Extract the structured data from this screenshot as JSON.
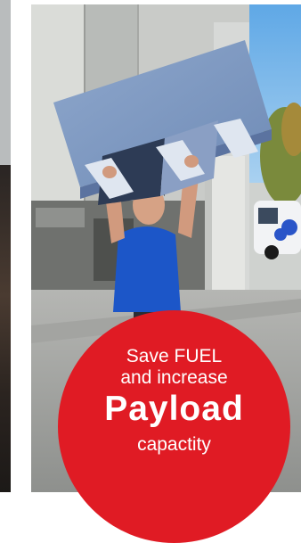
{
  "promo": {
    "line1": "Save FUEL",
    "line2": "and increase",
    "headline": "Payload",
    "line4": "capactity"
  },
  "colors": {
    "badge_red": "#e01b24",
    "text": "#ffffff",
    "panel_blue": "#7f9ac2",
    "shirt_blue": "#1c56c8"
  }
}
